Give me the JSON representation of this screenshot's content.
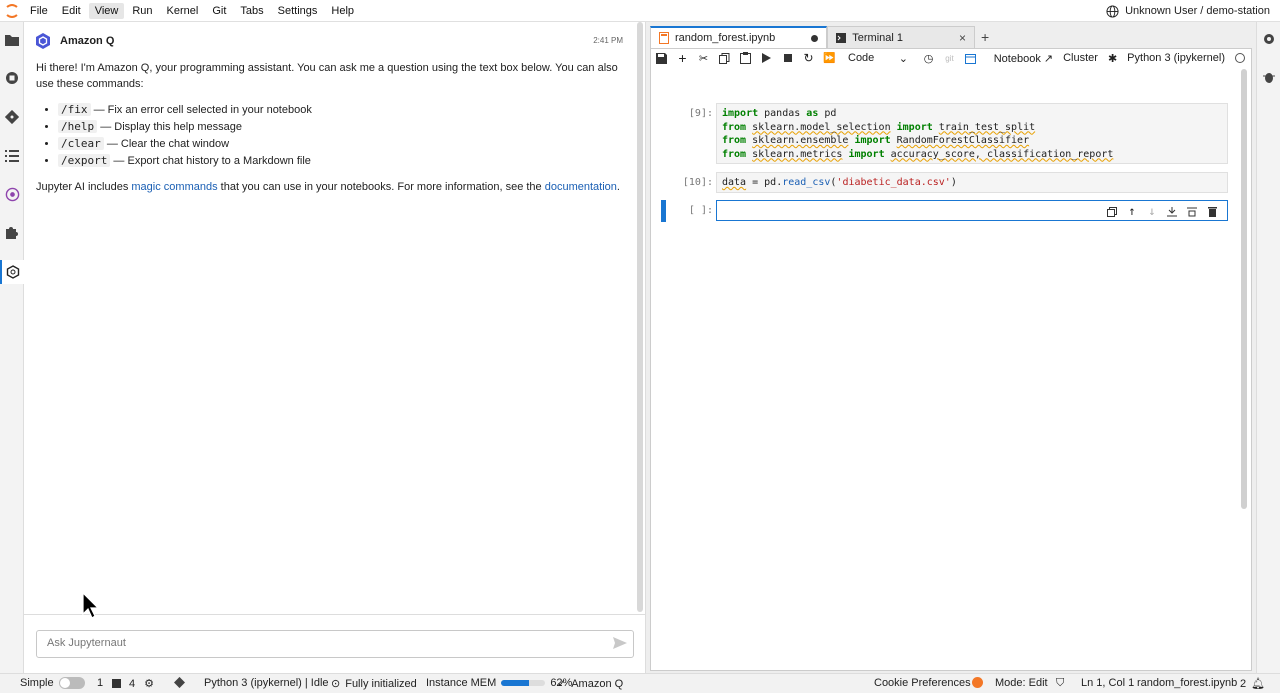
{
  "menu": {
    "items": [
      "File",
      "Edit",
      "View",
      "Run",
      "Kernel",
      "Git",
      "Tabs",
      "Settings",
      "Help"
    ],
    "user": "Unknown User / demo-station"
  },
  "chat": {
    "assistant_name": "Amazon Q",
    "time": "2:41 PM",
    "intro": "Hi there! I'm Amazon Q, your programming assistant. You can ask me a question using the text box below. You can also use these commands:",
    "commands": [
      {
        "cmd": "/fix",
        "desc": "— Fix an error cell selected in your notebook"
      },
      {
        "cmd": "/help",
        "desc": "— Display this help message"
      },
      {
        "cmd": "/clear",
        "desc": "— Clear the chat window"
      },
      {
        "cmd": "/export",
        "desc": "— Export chat history to a Markdown file"
      }
    ],
    "footer_pre": "Jupyter AI includes ",
    "footer_link1": "magic commands",
    "footer_mid": " that you can use in your notebooks. For more information, see the ",
    "footer_link2": "documentation",
    "footer_post": ".",
    "input_placeholder": "Ask Jupyternaut"
  },
  "tabs": [
    {
      "label": "random_forest.ipynb",
      "active": true
    },
    {
      "label": "Terminal 1",
      "active": false
    }
  ],
  "toolbar": {
    "cell_type": "Code",
    "notebook_label": "Notebook",
    "cluster_label": "Cluster",
    "kernel_label": "Python 3 (ipykernel)"
  },
  "cells": [
    {
      "prompt": "[9]:"
    },
    {
      "prompt": "[10]:"
    },
    {
      "prompt": "[ ]:"
    }
  ],
  "status": {
    "mode_simple": "Simple",
    "num1": "1",
    "num2": "4",
    "kernel": "Python 3 (ipykernel) | Idle",
    "init": "Fully initialized",
    "mem_label": "Instance MEM",
    "mem_percent": "62%",
    "mem_value": 62,
    "amazonq": "Amazon Q",
    "cookie": "Cookie Preferences",
    "mode": "Mode: Edit",
    "position": "Ln 1, Col 1",
    "filename": "random_forest.ipynb",
    "notifications": "2"
  }
}
